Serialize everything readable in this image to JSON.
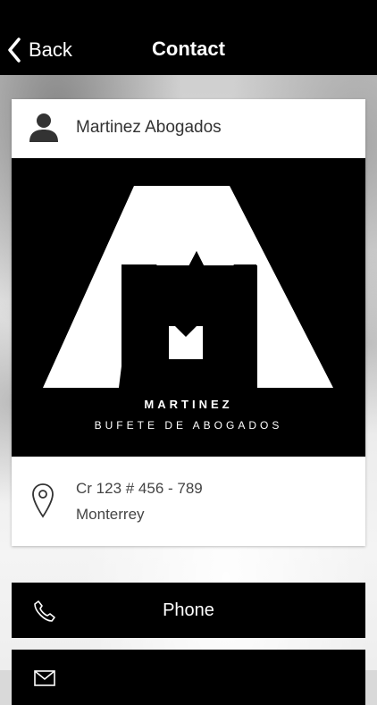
{
  "navbar": {
    "back_label": "Back",
    "title": "Contact"
  },
  "contact_card": {
    "name": "Martinez Abogados",
    "logo": {
      "line1": "MARTINEZ",
      "line2": "BUFETE DE ABOGADOS"
    },
    "address": {
      "line1": "Cr 123 # 456 - 789",
      "line2": "Monterrey"
    }
  },
  "actions": [
    {
      "label": "Phone",
      "icon": "phone-icon"
    },
    {
      "label": "",
      "icon": "email-icon"
    }
  ],
  "colors": {
    "nav_background": "#000000",
    "button_background": "#000000",
    "card_background": "#ffffff"
  }
}
